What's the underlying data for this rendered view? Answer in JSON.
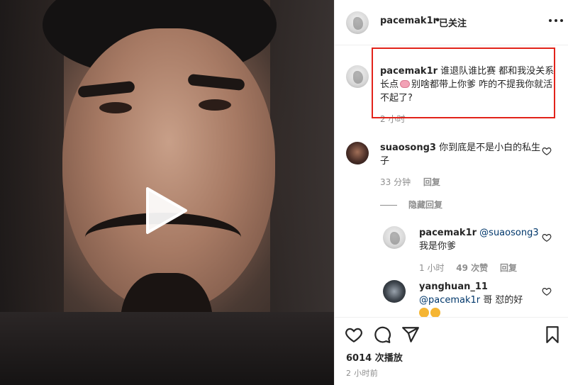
{
  "post": {
    "author": "pacemak1r",
    "follow_status": "已关注",
    "separator": "•",
    "caption_text_1": "谁退队谁比赛 都和我没关系 长点",
    "caption_text_2": "别啥都带上你爹 咋的不提我你就活不起了?",
    "caption_time": "2 小时",
    "views": "6014 次播放",
    "time_ago": "2 小时前"
  },
  "comments": [
    {
      "username": "suaosong3",
      "text": "你到底是不是小白的私生子",
      "time": "33 分钟",
      "reply_label": "回复",
      "hidden_replies_label": "隐藏回复"
    }
  ],
  "replies": [
    {
      "username": "pacemak1r",
      "mention": "@suaosong3",
      "text": "我是你爹",
      "time": "1 小时",
      "likes": "49 次赞",
      "reply_label": "回复"
    },
    {
      "username": "yanghuan_11",
      "mention": "@pacemak1r",
      "text": "哥 怼的好"
    }
  ],
  "icons": {
    "play": "play-icon",
    "more": "more-icon",
    "heart": "heart-icon",
    "comment": "comment-icon",
    "share": "share-icon",
    "save": "save-icon"
  },
  "colors": {
    "highlight": "#e2231a",
    "mention": "#00376b",
    "muted": "#8e8e8e"
  }
}
